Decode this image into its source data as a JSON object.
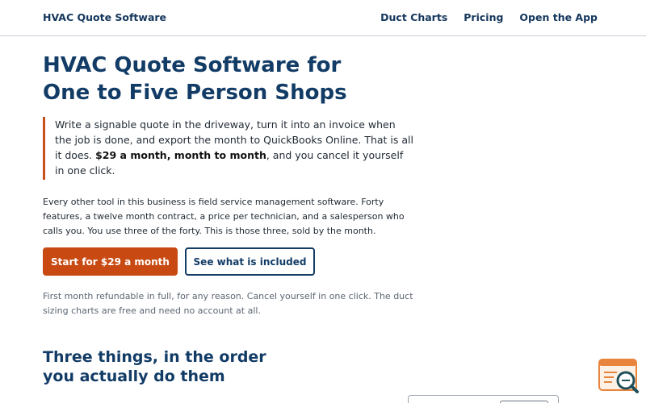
{
  "header": {
    "brand": "HVAC Quote Software",
    "nav": [
      {
        "label": "Duct Charts"
      },
      {
        "label": "Pricing"
      },
      {
        "label": "Open the App"
      }
    ]
  },
  "hero": {
    "title_line1": "HVAC Quote Software for",
    "title_line2": "One to Five Person Shops",
    "callout": {
      "text_before": "Write a signable quote in the driveway, turn it into an invoice when the job is done, and export the month to QuickBooks Online. That is all it does. ",
      "emphasis": "$29 a month, month to month",
      "text_after": ", and you cancel it yourself in one click."
    },
    "paragraph": "Every other tool in this business is field service management software. Forty features, a twelve month contract, a price per technician, and a salesperson who calls you. You use three of the forty. This is those three, sold by the month.",
    "primary_button": "Start for $29 a month",
    "secondary_button": "See what is included",
    "fineprint": "First month refundable in full, for any reason. Cancel yourself in one click. The duct sizing charts are free and need no account at all."
  },
  "section": {
    "title_line1": "Three things, in the order",
    "title_line2": "you actually do them"
  },
  "widget": {
    "icon": "search-help-icon",
    "accent": "#e8843c",
    "dark": "#1f4f5a"
  },
  "colors": {
    "brand_navy": "#123c66",
    "accent_orange": "#c84a12"
  }
}
